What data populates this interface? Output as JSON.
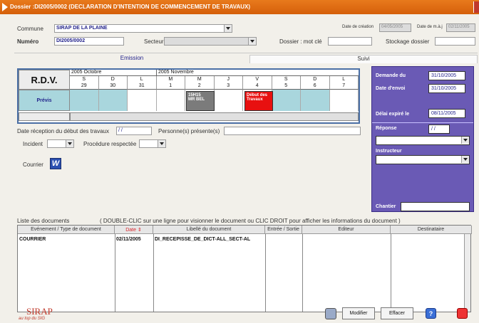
{
  "window": {
    "title": "Dossier :DI2005/0002 (DECLARATION D'INTENTION DE COMMENCEMENT DE TRAVAUX)"
  },
  "header": {
    "commune_label": "Commune",
    "commune_value": "SIRAP DE LA PLAINE",
    "numero_label": "Numéro",
    "numero_value": "DI2005/0002",
    "secteur_label": "Secteur",
    "date_creation_label": "Date de création",
    "date_creation_value": "04/05/2005",
    "date_maj_label": "Date de m.à.j",
    "date_maj_value": "02/11/2005",
    "dossier_motcle_label": "Dossier : mot clé",
    "stockage_label": "Stockage dossier"
  },
  "tabs": {
    "emission": "Emission",
    "suivi": "Suivi"
  },
  "rdv": {
    "title": "R.D.V.",
    "row_label": "Prévis",
    "month1": "2005 Octobre",
    "month2": "2005 Novembre",
    "days": [
      {
        "d": "S",
        "n": "29"
      },
      {
        "d": "D",
        "n": "30"
      },
      {
        "d": "L",
        "n": "31"
      },
      {
        "d": "M",
        "n": "1"
      },
      {
        "d": "M",
        "n": "2"
      },
      {
        "d": "J",
        "n": "3"
      },
      {
        "d": "V",
        "n": "4"
      },
      {
        "d": "S",
        "n": "5"
      },
      {
        "d": "D",
        "n": "6"
      },
      {
        "d": "L",
        "n": "7"
      }
    ],
    "event1": "15H15\nMR BEL",
    "event2": "Début des\nTravaux"
  },
  "form": {
    "date_reception_label": "Date réception du début des travaux",
    "date_reception_value": "/ /",
    "personnes_label": "Personne(s) présente(s)",
    "incident_label": "Incident",
    "procedure_label": "Procédure respectée",
    "courrier_label": "Courrier"
  },
  "panel": {
    "demande_label": "Demande du",
    "demande_value": "31/10/2005",
    "envoi_label": "Date d'envoi",
    "envoi_value": "31/10/2005",
    "delai_label": "Délai expiré le",
    "delai_value": "08/11/2005",
    "reponse_label": "Réponse",
    "reponse_value": "/ /",
    "instructeur_label": "Instructeur",
    "chantier_label": "Chantier"
  },
  "docs": {
    "list_label": "Liste des documents",
    "hint": "( DOUBLE-CLIC sur une ligne pour visionner le document  ou  CLIC DROIT  pour afficher les informations du document )",
    "columns": [
      "Evénement / Type de document",
      "Date ⇕",
      "Libellé du document",
      "Entrée / Sortie",
      "Editeur",
      "Destinataire"
    ],
    "rows": [
      {
        "type": "COURRIER",
        "date": "02/11/2005",
        "libelle": "DI_RECEPISSE_DE_DICT-ALL_SECT-AL",
        "es": "",
        "editeur": "",
        "dest": ""
      }
    ]
  },
  "footer": {
    "logo": "SIRAP",
    "tagline": "au top du SIG",
    "modifier": "Modifier",
    "effacer": "Effacer"
  },
  "colors": {
    "title": "#e06a12",
    "panel": "#6a5ab5",
    "event_gray": "#7b7b7b",
    "event_red": "#e81010",
    "date_header": "#d9262c"
  }
}
